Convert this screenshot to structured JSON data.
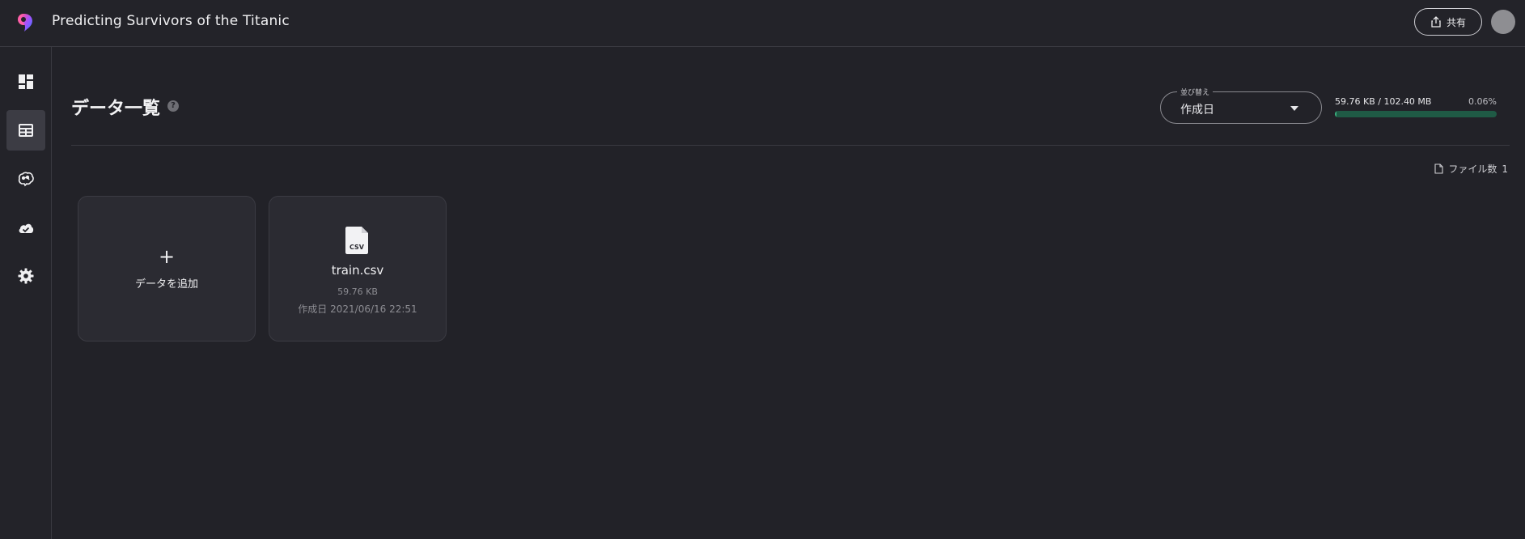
{
  "header": {
    "title": "Predicting Survivors of the Titanic",
    "share_label": "共有",
    "logo_icon": "app-logo-icon",
    "share_icon": "share-upload-icon"
  },
  "sidebar": {
    "items": [
      {
        "icon": "dashboard-icon",
        "active": false
      },
      {
        "icon": "table-icon",
        "active": true
      },
      {
        "icon": "brain-icon",
        "active": false
      },
      {
        "icon": "cloud-check-icon",
        "active": false
      },
      {
        "icon": "gear-icon",
        "active": false
      }
    ]
  },
  "main": {
    "title": "データ一覧",
    "help_icon": "?",
    "sort": {
      "legend": "並び替え",
      "value": "作成日"
    },
    "storage": {
      "text": "59.76 KB / 102.40 MB",
      "percent_label": "0.06%",
      "fraction": 0.0006
    },
    "file_count": {
      "label": "ファイル数",
      "value": "1"
    },
    "add_card": {
      "plus": "+",
      "label": "データを追加"
    },
    "files": [
      {
        "icon_text": "CSV",
        "name": "train.csv",
        "size": "59.76 KB",
        "created": "作成日 2021/06/16 22:51"
      }
    ]
  },
  "colors": {
    "background": "#222228",
    "card": "#2b2b32",
    "storage_track": "#1f5a45",
    "storage_fill": "#3bb07f",
    "active_nav": "#3c3c44"
  }
}
